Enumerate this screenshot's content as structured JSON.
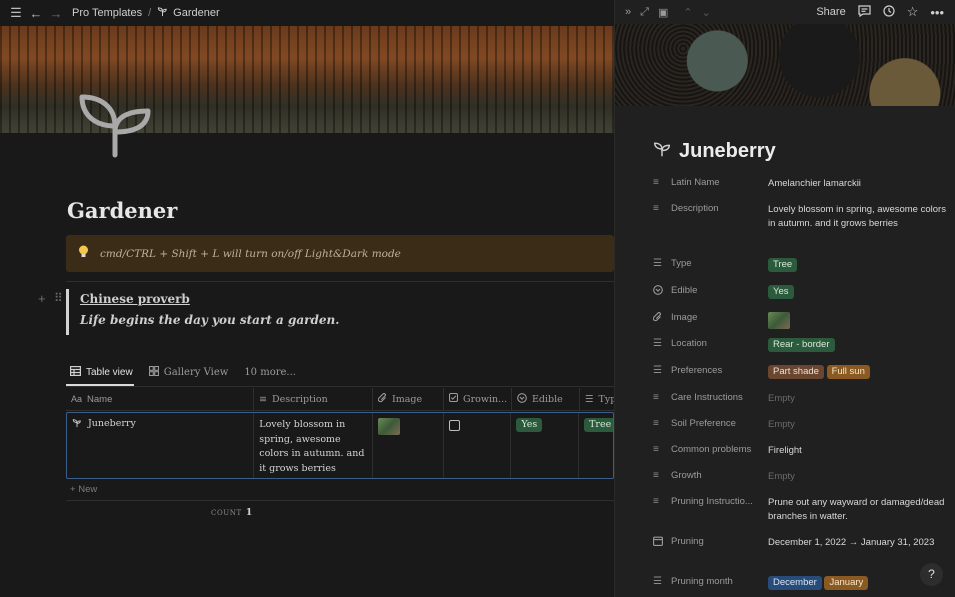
{
  "topbar": {
    "breadcrumb_parent": "Pro Templates",
    "breadcrumb_page": "Gardener"
  },
  "page": {
    "title": "Gardener",
    "callout": "cmd/CTRL + Shift + L will turn on/off Light&Dark mode",
    "quote_title": "Chinese proverb",
    "quote_body": "Life begins the day you start a garden."
  },
  "views": {
    "tabs": [
      "Table view",
      "Gallery View",
      "10 more..."
    ]
  },
  "table": {
    "columns": [
      "Name",
      "Description",
      "Image",
      "Growin...",
      "Edible",
      "Typ"
    ],
    "row": {
      "name": "Juneberry",
      "description": "Lovely blossom in spring, awesome colors in autumn. and it grows berries",
      "edible": "Yes",
      "type": "Tree"
    },
    "new_label": "New",
    "count_label": "COUNT",
    "count_value": "1"
  },
  "peek": {
    "share_label": "Share",
    "title": "Juneberry",
    "props": {
      "latin_name": {
        "label": "Latin Name",
        "value": "Amelanchier lamarckii"
      },
      "description": {
        "label": "Description",
        "value": "Lovely blossom in spring, awesome colors in autumn. and it grows berries"
      },
      "type": {
        "label": "Type",
        "value": "Tree"
      },
      "edible": {
        "label": "Edible",
        "value": "Yes"
      },
      "image": {
        "label": "Image"
      },
      "location": {
        "label": "Location",
        "value": "Rear - border"
      },
      "preferences": {
        "label": "Preferences",
        "values": [
          "Part shade",
          "Full sun"
        ]
      },
      "care": {
        "label": "Care Instructions",
        "value": "Empty"
      },
      "soil": {
        "label": "Soil Preference",
        "value": "Empty"
      },
      "problems": {
        "label": "Common problems",
        "value": "Firelight"
      },
      "growth": {
        "label": "Growth",
        "value": "Empty"
      },
      "pruning_instructions": {
        "label": "Pruning Instructio...",
        "value": "Prune out any wayward or damaged/dead branches in watter."
      },
      "pruning": {
        "label": "Pruning",
        "value": "December 1, 2022 → January 31, 2023"
      },
      "pruning_month": {
        "label": "Pruning month",
        "values": [
          "December",
          "January"
        ]
      }
    }
  },
  "help_label": "?",
  "colors": {
    "accent_border": "#3c5f8a",
    "tag_green": "#2b5a3c",
    "tag_blue": "#284c7a",
    "tag_brown": "#6a4630",
    "tag_orange": "#8a5a22",
    "callout_bg": "#3a2c17"
  },
  "icons": [
    "menu-icon",
    "back-arrow-icon",
    "forward-arrow-icon",
    "sprout-icon",
    "bulb-icon",
    "table-icon",
    "gallery-icon",
    "lines-icon",
    "paperclip-icon",
    "checkbox-icon",
    "edible-icon",
    "list-icon",
    "calendar-icon",
    "comment-icon",
    "clock-icon",
    "star-icon",
    "more-icon",
    "collapse-icon",
    "expand-icon",
    "window-icon",
    "chevron-up-icon",
    "chevron-down-icon"
  ]
}
